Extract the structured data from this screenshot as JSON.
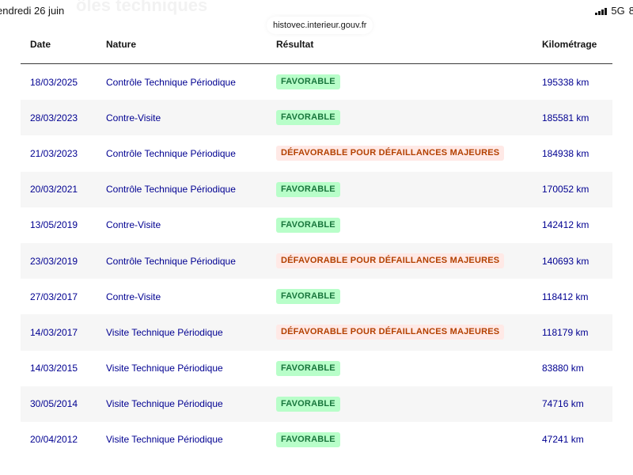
{
  "status_bar": {
    "time": "endredi 26 juin",
    "network": "5G",
    "battery": "8"
  },
  "browser": {
    "url": "histovec.interieur.gouv.fr"
  },
  "page": {
    "ghost_title": "ôles techniques"
  },
  "table": {
    "headers": {
      "date": "Date",
      "nature": "Nature",
      "result": "Résultat",
      "km": "Kilométrage"
    },
    "rows": [
      {
        "date": "18/03/2025",
        "nature": "Contrôle Technique Périodique",
        "result": "FAVORABLE",
        "status": "ok",
        "km": "195338 km"
      },
      {
        "date": "28/03/2023",
        "nature": "Contre-Visite",
        "result": "FAVORABLE",
        "status": "ok",
        "km": "185581 km"
      },
      {
        "date": "21/03/2023",
        "nature": "Contrôle Technique Périodique",
        "result": "DÉFAVORABLE POUR DÉFAILLANCES MAJEURES",
        "status": "ko",
        "km": "184938 km"
      },
      {
        "date": "20/03/2021",
        "nature": "Contrôle Technique Périodique",
        "result": "FAVORABLE",
        "status": "ok",
        "km": "170052 km"
      },
      {
        "date": "13/05/2019",
        "nature": "Contre-Visite",
        "result": "FAVORABLE",
        "status": "ok",
        "km": "142412 km"
      },
      {
        "date": "23/03/2019",
        "nature": "Contrôle Technique Périodique",
        "result": "DÉFAVORABLE POUR DÉFAILLANCES MAJEURES",
        "status": "ko",
        "km": "140693 km"
      },
      {
        "date": "27/03/2017",
        "nature": "Contre-Visite",
        "result": "FAVORABLE",
        "status": "ok",
        "km": "118412 km"
      },
      {
        "date": "14/03/2017",
        "nature": "Visite Technique Périodique",
        "result": "DÉFAVORABLE POUR DÉFAILLANCES MAJEURES",
        "status": "ko",
        "km": "118179 km"
      },
      {
        "date": "14/03/2015",
        "nature": "Visite Technique Périodique",
        "result": "FAVORABLE",
        "status": "ok",
        "km": "83880 km"
      },
      {
        "date": "30/05/2014",
        "nature": "Visite Technique Périodique",
        "result": "FAVORABLE",
        "status": "ok",
        "km": "74716 km"
      },
      {
        "date": "20/04/2012",
        "nature": "Visite Technique Périodique",
        "result": "FAVORABLE",
        "status": "ok",
        "km": "47241 km"
      }
    ]
  },
  "colors": {
    "link_blue": "#000091",
    "favorable_bg": "#b8fec9",
    "favorable_text": "#18753c",
    "defavorable_bg": "#ffe9e6",
    "defavorable_text": "#b34000",
    "row_alt_bg": "#f6f6f6"
  },
  "icons": [
    "signal-icon"
  ]
}
